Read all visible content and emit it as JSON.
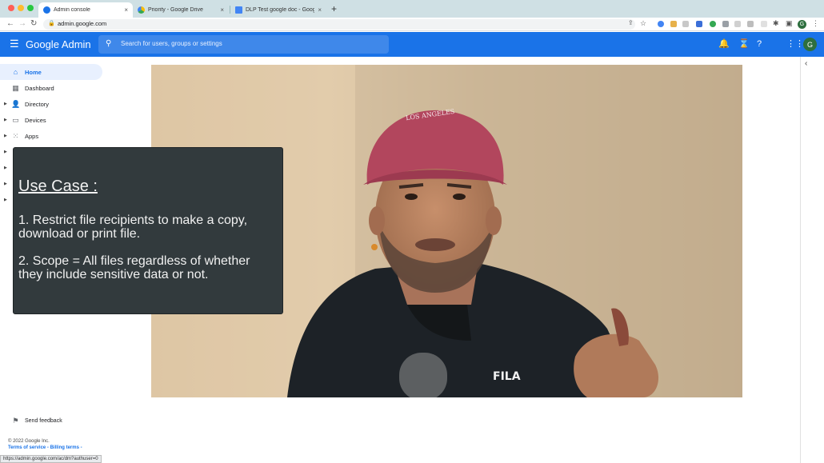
{
  "browser": {
    "tabs": [
      {
        "label": "Admin console",
        "close": "×",
        "favicon_color": "#1a73e8"
      },
      {
        "label": "Priority - Google Drive",
        "close": "×",
        "favicon_color": "#fbbc04"
      },
      {
        "label": "DLP Test google doc - Google D",
        "close": "×",
        "favicon_color": "#4285f4"
      }
    ],
    "new_tab": "+",
    "url": "admin.google.com",
    "profile_initial": "G",
    "status_url": "https://admin.google.com/ac/dm?authuser=0"
  },
  "header": {
    "app_title": "Google Admin",
    "search_placeholder": "Search for users, groups or settings",
    "avatar_initial": "G"
  },
  "sidebar": {
    "items": [
      {
        "label": "Home",
        "icon": "home-icon",
        "active": true
      },
      {
        "label": "Dashboard",
        "icon": "dashboard-icon",
        "active": false
      },
      {
        "label": "Directory",
        "icon": "person-icon",
        "active": false
      },
      {
        "label": "Devices",
        "icon": "devices-icon",
        "active": false
      },
      {
        "label": "Apps",
        "icon": "apps-grid-icon",
        "active": false
      }
    ],
    "feedback": "Send feedback",
    "copyright": "© 2022 Google Inc.",
    "footer_links": "Terms of service - Billing terms -"
  },
  "caption": {
    "title": "Use Case :",
    "lines": [
      "1. Restrict file recipients to make a copy, download or print file.",
      "2. Scope = All files regardless of whether they include sensitive data or not."
    ]
  },
  "video": {
    "cap_text": "LOS ANGELES",
    "shirt_logo": "FILA"
  },
  "colors": {
    "accent": "#1a73e8",
    "tab_bar": "#cfe0e4",
    "caption_bg": "#323a3d"
  }
}
